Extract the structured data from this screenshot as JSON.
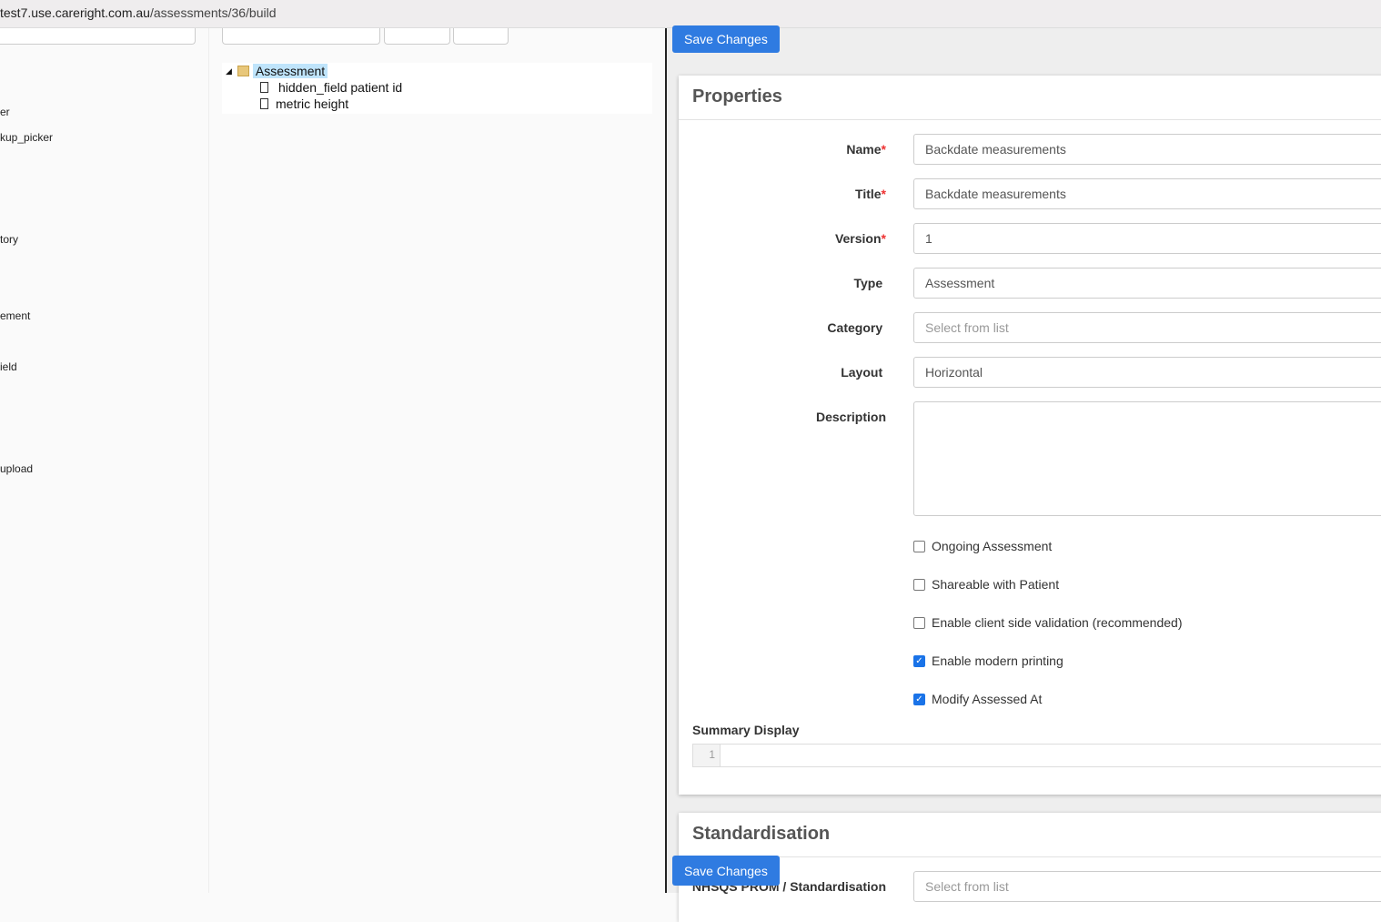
{
  "browser": {
    "url_host": "test7.use.careright.com.au",
    "url_path": "/assessments/36/build"
  },
  "sidebar": {
    "items": [
      "er",
      "kup_picker",
      "tory",
      "ement",
      "ield",
      "upload"
    ]
  },
  "tree": {
    "root": "Assessment",
    "children": [
      "hidden_field patient id",
      "metric height"
    ]
  },
  "actions": {
    "save_label": "Save Changes"
  },
  "properties": {
    "title": "Properties",
    "fields": [
      {
        "label": "Name",
        "required": true,
        "value": "Backdate measurements"
      },
      {
        "label": "Title",
        "required": true,
        "value": "Backdate measurements"
      },
      {
        "label": "Version",
        "required": true,
        "value": "1"
      },
      {
        "label": "Type",
        "required": false,
        "value": "Assessment"
      },
      {
        "label": "Category",
        "required": false,
        "placeholder": "Select from list"
      },
      {
        "label": "Layout",
        "required": false,
        "value": "Horizontal"
      }
    ],
    "description_label": "Description",
    "checkboxes": [
      {
        "label": "Ongoing Assessment",
        "checked": false
      },
      {
        "label": "Shareable with Patient",
        "checked": false
      },
      {
        "label": "Enable client side validation (recommended)",
        "checked": false
      },
      {
        "label": "Enable modern printing",
        "checked": true
      },
      {
        "label": "Modify Assessed At",
        "checked": true
      }
    ],
    "summary_label": "Summary Display",
    "summary_line": "1"
  },
  "standardisation": {
    "title": "Standardisation",
    "field_label": "NHSQS PROM / Standardisation",
    "placeholder": "Select from list"
  },
  "colors": {
    "accent": "#2f7be1"
  }
}
